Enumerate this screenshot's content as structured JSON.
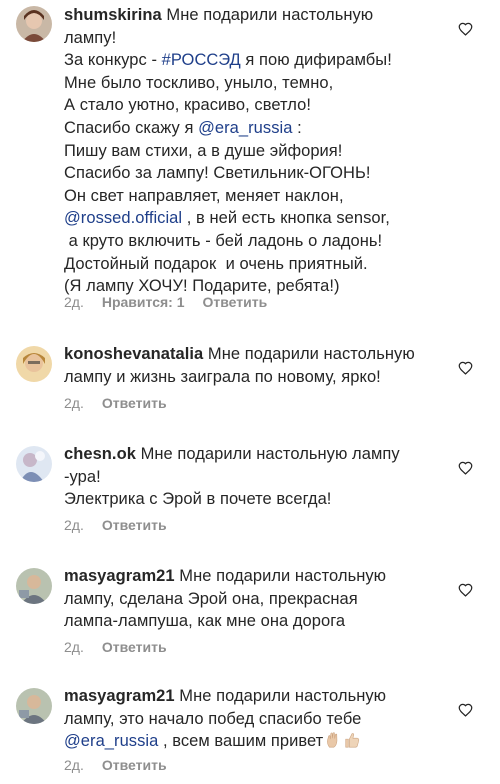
{
  "comments": [
    {
      "username": "shumskirina",
      "parts": [
        {
          "t": " Мне подарили настольную\nлампу!\nЗа конкурс - "
        },
        {
          "t": "#РОССЭД",
          "link": true
        },
        {
          "t": " я пою дифирамбы!\nМне было тоскливо, уныло, темно,\nА стало уютно, красиво, светло!\nСпасибо скажу я "
        },
        {
          "t": "@era_russia",
          "link": true
        },
        {
          "t": " :\nПишу вам стихи, а в душе эйфория!\nСпасибо за лампу! Светильник-ОГОНЬ!\nОн свет направляет, меняет наклон,\n"
        },
        {
          "t": "@rossed.official",
          "link": true
        },
        {
          "t": " , в ней есть кнопка sensor,\n а круто включить - бей ладонь о ладонь!\nДостойный подарок  и очень приятный.\n(Я лампу ХОЧУ! Подарите, ребята!)"
        }
      ],
      "time": "2д.",
      "likes": "Нравится: 1",
      "reply": "Ответить"
    },
    {
      "username": "konoshevanatalia",
      "parts": [
        {
          "t": " Мне подарили настольную\nлампу и жизнь заиграла по новому, ярко!"
        }
      ],
      "time": "2д.",
      "reply": "Ответить"
    },
    {
      "username": "chesn.ok",
      "parts": [
        {
          "t": " Мне подарили настольную лампу\n-ура!\nЭлектрика с Эрой в почете всегда!"
        }
      ],
      "time": "2д.",
      "reply": "Ответить"
    },
    {
      "username": "masyagram21",
      "parts": [
        {
          "t": " Мне подарили настольную\nлампу, сделана Эрой она, прекрасная\nлампа-лампуша, как мне она дорога"
        }
      ],
      "time": "2д.",
      "reply": "Ответить"
    },
    {
      "username": "masyagram21",
      "parts": [
        {
          "t": " Мне подарили настольную\nлампу, это начало побед спасибо тебе\n"
        },
        {
          "t": "@era_russia",
          "link": true
        },
        {
          "t": " , всем вашим привет"
        }
      ],
      "emojis": [
        "raised-hand-emoji",
        "thumbs-up-emoji"
      ],
      "time": "2д.",
      "reply": "Ответить"
    }
  ],
  "icons": {
    "heart": "heart-outline-icon"
  },
  "colors": {
    "text": "#262626",
    "link": "#1f3f8a",
    "meta": "#8e8e8e"
  }
}
